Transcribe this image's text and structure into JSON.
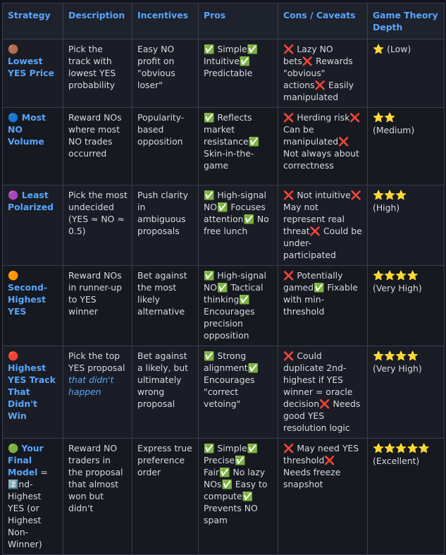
{
  "headers": [
    "Strategy",
    "Description",
    "Incentives",
    "Pros",
    "Cons / Caveats",
    "Game Theory Depth"
  ],
  "rows": [
    {
      "icon": "🟤",
      "strategy": "Lowest YES Price",
      "description": "Pick the track with lowest YES probability",
      "description_em": "",
      "incentives": "Easy NO profit on \"obvious loser\"",
      "pros": "✅ Simple✅ Intuitive✅ Predictable",
      "cons": "❌ Lazy NO bets❌ Rewards \"obvious\" actions❌ Easily manipulated",
      "stars": "⭐",
      "depth": "(Low)"
    },
    {
      "icon": "🔵",
      "strategy": "Most NO Volume",
      "description": "Reward NOs where most NO trades occurred",
      "description_em": "",
      "incentives": "Popularity-based opposition",
      "pros": "✅ Reflects market resistance✅ Skin-in-the-game",
      "cons": "❌ Herding risk❌ Can be manipulated❌ Not always about correctness",
      "stars": "⭐⭐",
      "depth": "(Medium)"
    },
    {
      "icon": "🟣",
      "strategy": "Least Polarized",
      "description": "Pick the most undecided (YES ≈ NO ≈ 0.5)",
      "description_em": "",
      "incentives": "Push clarity in ambiguous proposals",
      "pros": "✅ High-signal NO✅ Focuses attention✅ No free lunch",
      "cons": "❌ Not intuitive❌ May not represent real threat❌ Could be under-participated",
      "stars": "⭐⭐⭐",
      "depth": "(High)"
    },
    {
      "icon": "🟠",
      "strategy": "Second-Highest YES",
      "description": "Reward NOs in runner-up to YES winner",
      "description_em": "",
      "incentives": "Bet against the most likely alternative",
      "pros": "✅ High-signal NO✅ Tactical thinking✅ Encourages precision opposition",
      "cons": "❌ Potentially gamed✅ Fixable with min-threshold",
      "stars": "⭐⭐⭐⭐",
      "depth": "(Very High)"
    },
    {
      "icon": "🔴",
      "strategy": "Highest YES Track That Didn't Win",
      "description": "Pick the top YES proposal",
      "description_em": "that didn't happen",
      "incentives": "Bet against a likely, but ultimately wrong proposal",
      "pros": "✅ Strong alignment✅ Encourages \"correct vetoing\"",
      "cons": "❌ Could duplicate 2nd-highest if YES winner = oracle decision❌ Needs good YES resolution logic",
      "stars": "⭐⭐⭐⭐",
      "depth": "(Very High)"
    },
    {
      "icon": "🟢",
      "strategy": "Your Final Model",
      "strategy_suffix": " = 2️⃣nd-Highest YES (or Highest Non-Winner)",
      "description": "Reward NO traders in the proposal that almost won but didn't",
      "description_em": "",
      "incentives": "Express true preference order",
      "pros": "✅ Simple✅ Precise✅ Fair✅ No lazy NOs✅ Easy to compute✅ Prevents NO spam",
      "cons": "❌ May need YES threshold❌ Needs freeze snapshot",
      "stars": "⭐⭐⭐⭐⭐",
      "depth": "(Excellent)"
    }
  ]
}
